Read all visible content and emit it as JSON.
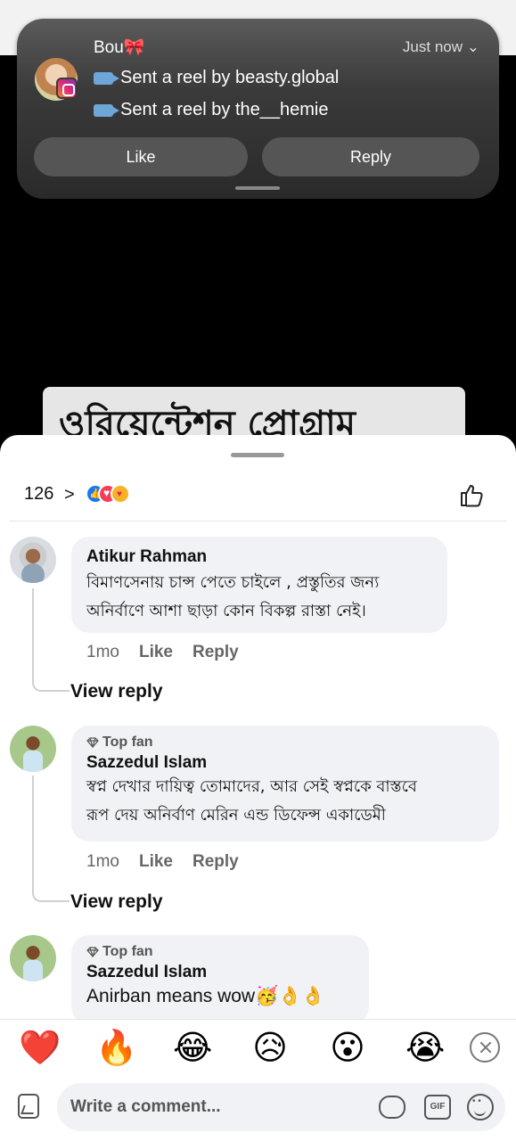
{
  "video": {
    "banner_text": "ওরিয়েন্টেশন প্রোগ্রাম"
  },
  "notification": {
    "sender": "Bou🎀",
    "time": "Just now",
    "lines": [
      "Sent a reel by beasty.global",
      "Sent a reel by the__hemie"
    ],
    "like_label": "Like",
    "reply_label": "Reply"
  },
  "reactions": {
    "count": "126",
    "chevron": ">"
  },
  "comments": [
    {
      "author": "Atikur Rahman",
      "badge": "",
      "text_lines": [
        "বিমাণসেনায়  চান্স পেতে চাইলে , প্রস্তুতির জন্য",
        "অনির্বাণে আশা ছাড়া কোন বিকল্প রাস্তা নেই।"
      ],
      "time": "1mo",
      "like": "Like",
      "reply": "Reply",
      "view_reply": "View reply"
    },
    {
      "author": "Sazzedul Islam",
      "badge": "Top fan",
      "text_lines": [
        "স্বপ্ন দেখার দায়িত্ব তোমাদের, আর সেই স্বপ্নকে বাস্তবে",
        "রূপ দেয় অনির্বাণ মেরিন এন্ড ডিফেন্স একাডেমী"
      ],
      "time": "1mo",
      "like": "Like",
      "reply": "Reply",
      "view_reply": "View reply"
    },
    {
      "author": "Sazzedul Islam",
      "badge": "Top fan",
      "text_lines": [
        "Anirban means wow🥳👌👌"
      ]
    }
  ],
  "emoji_bar": [
    "❤️",
    "🔥",
    "😂",
    "😥",
    "😮",
    "😭"
  ],
  "composer": {
    "placeholder": "Write a comment..."
  },
  "icons": {
    "gif_label": "GIF",
    "accent": "#1877f2"
  }
}
